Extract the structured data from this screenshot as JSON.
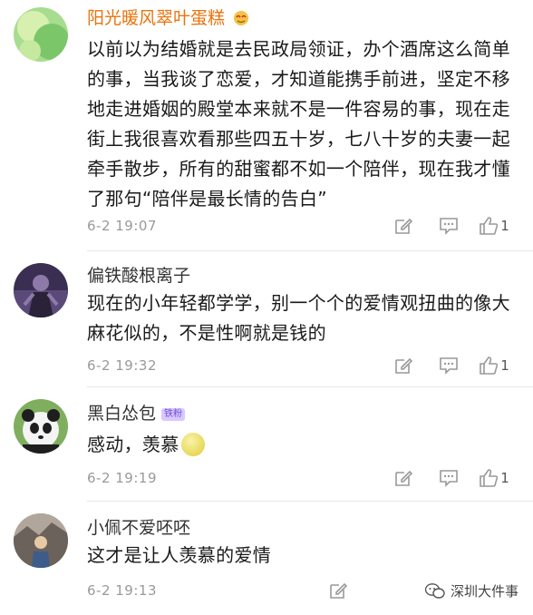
{
  "comments": [
    {
      "username": "阳光暖风翠叶蛋糕",
      "text": "以前以为结婚就是去民政局领证，办个酒席这么简单的事，当我谈了恋爱，才知道能携手前进，坚定不移地走进婚姻的殿堂本来就不是一件容易的事，现在走街上我很喜欢看那些四五十岁，七八十岁的夫妻一起牵手散步，所有的甜蜜都不如一个陪伴，现在我才懂了那句“陪伴是最长情的告白”",
      "time": "6-2 19:07",
      "likes": "1"
    },
    {
      "username": "偏铁酸根离子",
      "text": "现在的小年轻都学学，别一个个的爱情观扭曲的像大麻花似的，不是性啊就是钱的",
      "time": "6-2 19:32",
      "likes": "1"
    },
    {
      "username": "黑白怂包",
      "badge": "铁粉",
      "text": "感动，羡慕",
      "time": "6-2 19:19",
      "likes": "1"
    },
    {
      "username": "小佩不爱呸呸",
      "text": "这才是让人羡慕的爱情",
      "time": "6-2 19:13"
    }
  ],
  "watermark": "深圳大件事",
  "icons": [
    "edit-icon",
    "comment-icon",
    "like-icon"
  ],
  "colors": {
    "vip_name": "#e8730c",
    "time": "#9a9a9a",
    "divider": "#e6e6e6"
  }
}
